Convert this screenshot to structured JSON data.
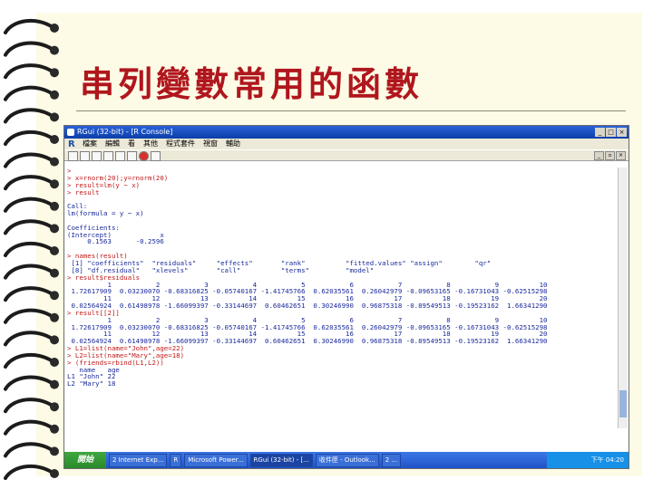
{
  "slide_title": "串列變數常用的函數",
  "window": {
    "title": "RGui (32-bit) - [R Console]",
    "menu": [
      "檔案",
      "編輯",
      "看",
      "其他",
      "程式套件",
      "視窗",
      "輔助"
    ]
  },
  "console_lines": [
    {
      "t": ">",
      "in": true
    },
    {
      "t": "> x=rnorm(20);y=rnorm(20)",
      "in": true
    },
    {
      "t": "> result=lm(y ~ x)",
      "in": true
    },
    {
      "t": "> result",
      "in": true
    },
    {
      "t": "",
      "in": false
    },
    {
      "t": "Call:",
      "in": false
    },
    {
      "t": "lm(formula = y ~ x)",
      "in": false
    },
    {
      "t": "",
      "in": false
    },
    {
      "t": "Coefficients:",
      "in": false
    },
    {
      "t": "(Intercept)            x",
      "in": false
    },
    {
      "t": "     0.1563      -0.2596",
      "in": false
    },
    {
      "t": "",
      "in": false
    },
    {
      "t": "> names(result)",
      "in": true
    },
    {
      "t": " [1] \"coefficients\"  \"residuals\"     \"effects\"       \"rank\"          \"fitted.values\" \"assign\"        \"qr\"",
      "in": false
    },
    {
      "t": " [8] \"df.residual\"   \"xlevels\"       \"call\"          \"terms\"         \"model\"",
      "in": false
    },
    {
      "t": "> result$residuals",
      "in": true
    },
    {
      "t": "          1           2           3           4           5           6           7           8           9          10",
      "in": false
    },
    {
      "t": " 1.72617909  0.03230070 -0.68316825 -0.05740167 -1.41745766  0.62035561  0.26042979 -0.09653165 -0.16731043 -0.62515298",
      "in": false
    },
    {
      "t": "         11          12          13          14          15          16          17          18          19          20",
      "in": false
    },
    {
      "t": " 0.02564924  0.61498978 -1.66099397 -0.33144697  0.60462651  0.30246990  0.96875318 -0.89549513 -0.19523162  1.66341290",
      "in": false
    },
    {
      "t": "> result[[2]]",
      "in": true
    },
    {
      "t": "          1           2           3           4           5           6           7           8           9          10",
      "in": false
    },
    {
      "t": " 1.72617909  0.03230070 -0.68316825 -0.05740167 -1.41745766  0.62035561  0.26042979 -0.09653165 -0.16731043 -0.62515298",
      "in": false
    },
    {
      "t": "         11          12          13          14          15          16          17          18          19          20",
      "in": false
    },
    {
      "t": " 0.02564924  0.61498978 -1.66099397 -0.33144697  0.60462651  0.30246990  0.96875318 -0.89549513 -0.19523162  1.66341290",
      "in": false
    },
    {
      "t": "> L1=list(name=\"John\",age=22)",
      "in": true
    },
    {
      "t": "> L2=list(name=\"Mary\",age=18)",
      "in": true
    },
    {
      "t": "> (friends=rbind(L1,L2))",
      "in": true
    },
    {
      "t": "   name   age",
      "in": false
    },
    {
      "t": "L1 \"John\" 22",
      "in": false
    },
    {
      "t": "L2 \"Mary\" 18",
      "in": false
    }
  ],
  "taskbar": {
    "start": "開始",
    "tasks": [
      "2 Internet Exp...",
      "R",
      "Microsoft Power...",
      "RGui (32-bit) - [...",
      "收件匣 - Outlook...",
      "2 ..."
    ],
    "clock": "下午 04:20"
  }
}
